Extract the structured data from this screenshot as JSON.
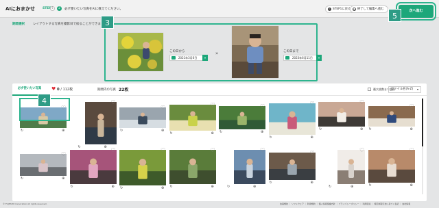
{
  "header": {
    "app_title": "AIにおまかせ",
    "step_label": "STEP",
    "step1": "1",
    "step2": "2",
    "step_desc": "必ず使いたい写真をAIに教えてください。",
    "back_step1_btn": "STEP1に戻る",
    "save_exit_btn": "終了して編集へ進む",
    "next_btn": "次へ進む"
  },
  "period": {
    "label": "期間選択",
    "description": "レイアウトする写真を撮影日で絞ることができます。",
    "from_label": "この日から",
    "from_date": "2021年3月6日",
    "to_label": "この日まで",
    "to_date": "2023年6月11日",
    "separator": "»"
  },
  "badges": {
    "b3": "3",
    "b4": "4",
    "b5": "5"
  },
  "gallery": {
    "tab_must": "必ず使いたい写真",
    "heart_selected": "0",
    "heart_total": "/ 112枚",
    "in_period_label": "期間内の写真",
    "in_period_count": "22枚",
    "select_label": "最大枚数まで選択",
    "sort_value": "ファイル名(A-Z)",
    "rows": [
      [
        {
          "colors": [
            "#7fa8c6",
            "#d9c9a5",
            "#4f7c4a"
          ]
        },
        {
          "colors": [
            "#5a4a3e",
            "#c8b59a",
            "#2f3a46"
          ]
        },
        {
          "colors": [
            "#9aa5ae",
            "#3a4a5c",
            "#d6dde2"
          ]
        },
        {
          "colors": [
            "#6a8c3e",
            "#c9d24a",
            "#e8e0b0"
          ]
        },
        {
          "colors": [
            "#4b7c3a",
            "#9ab46a",
            "#2f5a36"
          ]
        },
        {
          "colors": [
            "#6fb5c9",
            "#c95a7a",
            "#e8e6d8"
          ]
        },
        {
          "colors": [
            "#c9a895",
            "#f2ede6",
            "#3e3a36"
          ]
        },
        {
          "colors": [
            "#8a6a4e",
            "#2f4a7c",
            "#e6ded0"
          ]
        }
      ],
      [
        {
          "colors": [
            "#b4b9be",
            "#d9c4c9",
            "#6a6e72"
          ]
        },
        {
          "colors": [
            "#a6547a",
            "#e2a6c0",
            "#4a3a3e"
          ]
        },
        {
          "colors": [
            "#7a9a3a",
            "#d6d24a",
            "#3e5a2a"
          ]
        },
        {
          "colors": [
            "#5a7c3a",
            "#8aa66a",
            "#3e4e2e"
          ]
        },
        {
          "colors": [
            "#6d8eb0",
            "#c8d3de",
            "#3b4a5e"
          ]
        },
        {
          "colors": [
            "#6c5a4a",
            "#9aa5ae",
            "#3a3e42"
          ]
        },
        {
          "colors": [
            "#f0ece8",
            "#d8d2cc",
            "#8a7e74"
          ]
        },
        {
          "colors": [
            "#b88a6a",
            "#e8ddd2",
            "#5a4a3e"
          ]
        }
      ]
    ]
  },
  "footer": {
    "copyright": "© FUJIFILM Corporation All rights reserved.",
    "links": "会員規約 ｜ ソフトウェア ｜ 利用規約 ｜ 個人情報保護方針 ｜ ブライバシーポリシー ｜ 利用環境 ｜ 特定商取引法に基づく表記 ｜ 会社情報"
  },
  "colors": {
    "accent": "#1da77a",
    "highlight": "#2db48e",
    "badge": "#2e9c86"
  }
}
